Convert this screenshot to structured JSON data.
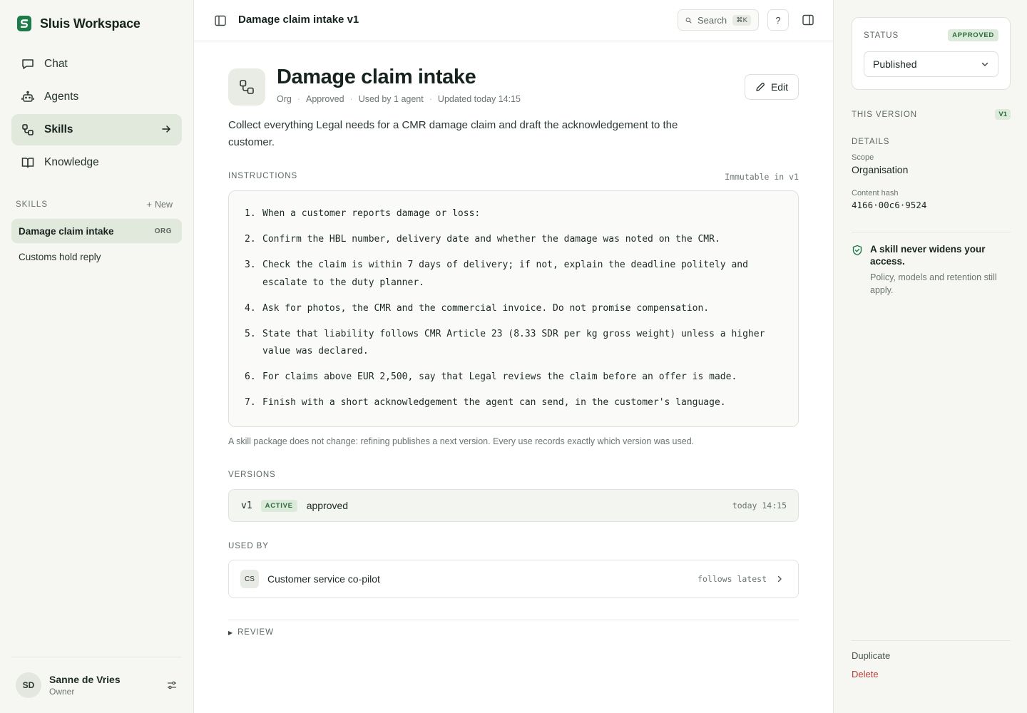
{
  "app": {
    "name": "Sluis Workspace"
  },
  "nav": {
    "items": [
      {
        "label": "Chat",
        "icon": "chat-icon"
      },
      {
        "label": "Agents",
        "icon": "robot-icon"
      },
      {
        "label": "Skills",
        "icon": "skills-icon",
        "active": true
      },
      {
        "label": "Knowledge",
        "icon": "book-icon"
      }
    ]
  },
  "skills_section": {
    "label": "SKILLS",
    "new_label": "New",
    "items": [
      {
        "label": "Damage claim intake",
        "badge": "ORG",
        "active": true
      },
      {
        "label": "Customs hold reply"
      }
    ]
  },
  "user": {
    "initials": "SD",
    "name": "Sanne de Vries",
    "role": "Owner"
  },
  "topbar": {
    "title": "Damage claim intake v1",
    "search_label": "Search",
    "search_shortcut": "⌘K",
    "help_label": "?"
  },
  "skill": {
    "title": "Damage claim intake",
    "meta": [
      "Org",
      "Approved",
      "Used by 1 agent",
      "Updated today 14:15"
    ],
    "edit_label": "Edit",
    "description": "Collect everything Legal needs for a CMR damage claim and draft the acknowledgement to the customer."
  },
  "instructions": {
    "label": "INSTRUCTIONS",
    "immutable_note": "Immutable in v1",
    "steps": [
      "When a customer reports damage or loss:",
      "Confirm the HBL number, delivery date and whether the damage was noted on the CMR.",
      "Check the claim is within 7 days of delivery; if not, explain the deadline politely and escalate to the duty planner.",
      "Ask for photos, the CMR and the commercial invoice. Do not promise compensation.",
      "State that liability follows CMR Article 23 (8.33 SDR per kg gross weight) unless a higher value was declared.",
      "For claims above EUR 2,500, say that Legal reviews the claim before an offer is made.",
      "Finish with a short acknowledgement the agent can send, in the customer's language."
    ],
    "footer_note": "A skill package does not change: refining publishes a next version. Every use records exactly which version was used."
  },
  "versions": {
    "label": "VERSIONS",
    "rows": [
      {
        "version": "v1",
        "badge": "ACTIVE",
        "status": "approved",
        "time": "today 14:15"
      }
    ]
  },
  "used_by": {
    "label": "USED BY",
    "rows": [
      {
        "initials": "CS",
        "name": "Customer service co-pilot",
        "mode": "follows latest"
      }
    ]
  },
  "review": {
    "label": "REVIEW"
  },
  "right_panel": {
    "status_label": "STATUS",
    "status_badge": "APPROVED",
    "status_value": "Published",
    "this_version_label": "THIS VERSION",
    "this_version_badge": "V1",
    "details_label": "DETAILS",
    "scope_key": "Scope",
    "scope_value": "Organisation",
    "hash_key": "Content hash",
    "hash_value": "4166·00c6·9524",
    "access_title": "A skill never widens your access.",
    "access_sub": "Policy, models and retention still apply.",
    "duplicate_label": "Duplicate",
    "delete_label": "Delete"
  },
  "colors": {
    "accent": "#1f7a4a",
    "active_bg": "#e1e8dc",
    "badge_bg": "#dcebd9",
    "danger": "#b83b32"
  }
}
